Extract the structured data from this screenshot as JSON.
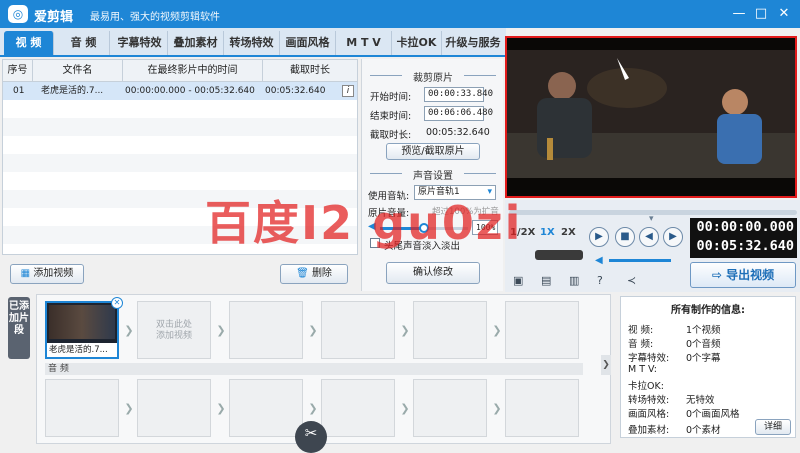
{
  "window": {
    "app_name": "爱剪辑",
    "slogan": "最易用、强大的视频剪辑软件",
    "minimize": "—",
    "maximize": "□",
    "close": "✕",
    "logo_glyph": "◎"
  },
  "tabs": [
    "视 频",
    "音 频",
    "字幕特效",
    "叠加素材",
    "转场特效",
    "画面风格",
    "M T V",
    "卡拉OK",
    "升级与服务"
  ],
  "list": {
    "headers": [
      "序号",
      "文件名",
      "在最终影片中的时间",
      "截取时长"
    ],
    "rows": [
      {
        "index": "01",
        "file": "老虎是活的.7...",
        "span": "00:00:00.000 - 00:05:32.640",
        "duration": "00:05:32.640"
      }
    ],
    "info_glyph": "i"
  },
  "buttons": {
    "add_video": "添加视频",
    "delete": "删除"
  },
  "clip": {
    "section": "裁剪原片",
    "start_label": "开始时间:",
    "start": "00:00:33.840",
    "end_label": "结束时间:",
    "end": "00:06:06.480",
    "len_label": "截取时长:",
    "len": "00:05:32.640",
    "preview_button": "预览/截取原片"
  },
  "audio": {
    "section": "声音设置",
    "track_label": "使用音轨:",
    "track_value": "原片音轨1",
    "volume_label": "原片音量:",
    "volume_hint": "超过100%为扩音",
    "volume_value": "100%",
    "volume_level": 0.5,
    "fade_label": "头尾声音淡入淡出",
    "confirm": "确认修改"
  },
  "player": {
    "speeds": [
      "1/2X",
      "1X",
      "2X"
    ],
    "current_time": "00:00:00.000",
    "total_time": "00:05:32.640",
    "export": "导出视频"
  },
  "sidebar_tab": "已添加片段",
  "timeline": {
    "clip_label": "老虎是活的.7...",
    "placeholder": "双击此处\n添加视频",
    "audio_label": "音 频"
  },
  "info": {
    "title": "所有制作的信息:",
    "items": [
      {
        "name": "视  频:",
        "value": "1个视频"
      },
      {
        "name": "音  频:",
        "value": "0个音频"
      },
      {
        "name": "字幕特效:",
        "value": "0个字幕"
      },
      {
        "name": "M  T  V:",
        "value": ""
      },
      {
        "name": "卡拉OK:",
        "value": ""
      },
      {
        "name": "转场特效:",
        "value": "无特效"
      },
      {
        "name": "画面风格:",
        "value": "0个画面风格"
      },
      {
        "name": "叠加素材:",
        "value": "0个素材"
      }
    ],
    "detail": "详细"
  },
  "watermark": "百度I2 gu0zi"
}
